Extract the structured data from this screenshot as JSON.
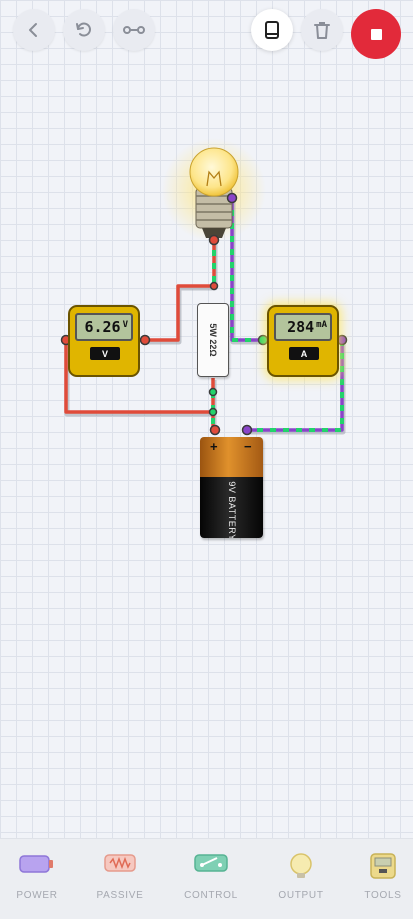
{
  "toolbar": {
    "back_icon": "chevron-left-icon",
    "undo_icon": "rotate-ccw-icon",
    "link_icon": "connection-icon",
    "book_icon": "book-icon",
    "trash_icon": "trash-icon",
    "stop_icon": "stop-icon",
    "stop_color": "#e22a3a"
  },
  "components": {
    "voltmeter": {
      "value": "6.26",
      "unit": "V",
      "label": "V"
    },
    "ammeter": {
      "value": "284",
      "unit": "mA",
      "label": "A"
    },
    "resistor": {
      "label": "5W 22Ω"
    },
    "battery": {
      "plus": "+",
      "minus": "−",
      "label": "9V BATTERY"
    },
    "bulb": {
      "state": "lit"
    }
  },
  "wire_colors": {
    "positive": "#e04b3a",
    "negative": "#8a44c9",
    "current": "#22d36b"
  },
  "categories": [
    {
      "label": "POWER",
      "icon": "battery-icon"
    },
    {
      "label": "PASSIVE",
      "icon": "resistor-icon"
    },
    {
      "label": "CONTROL",
      "icon": "switch-icon"
    },
    {
      "label": "OUTPUT",
      "icon": "bulb-icon"
    },
    {
      "label": "TOOLS",
      "icon": "meter-icon"
    }
  ]
}
